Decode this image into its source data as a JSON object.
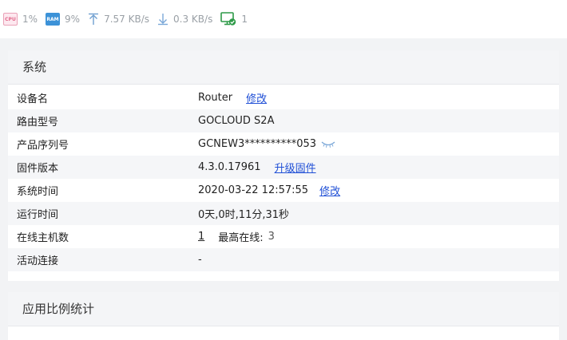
{
  "statusbar": {
    "cpu": {
      "chip_text": "CPU",
      "value": "1%"
    },
    "ram": {
      "chip_text": "RAM",
      "value": "9%"
    },
    "upload": {
      "value": "7.57 KB/s"
    },
    "download": {
      "value": "0.3 KB/s"
    },
    "clients": {
      "value": "1"
    }
  },
  "system": {
    "title": "系统",
    "rows": [
      {
        "label": "设备名",
        "value": "Router",
        "action": "修改"
      },
      {
        "label": "路由型号",
        "value": "GOCLOUD S2A"
      },
      {
        "label": "产品序列号",
        "value": "GCNEW3**********053"
      },
      {
        "label": "固件版本",
        "value": "4.3.0.17961",
        "action": "升级固件"
      },
      {
        "label": "系统时间",
        "value": "2020-03-22 12:57:55",
        "action": "修改"
      },
      {
        "label": "运行时间",
        "value": "0天,0时,11分,31秒"
      },
      {
        "label": "在线主机数",
        "value": "1",
        "extra_label": "最高在线:",
        "extra_value": "3"
      },
      {
        "label": "活动连接",
        "value": "-"
      }
    ]
  },
  "app_stats": {
    "title": "应用比例统计"
  },
  "colors": {
    "link": "#1f4fd6",
    "card_header_bg": "#f4f5f7",
    "page_bg": "#f2f3f5"
  }
}
